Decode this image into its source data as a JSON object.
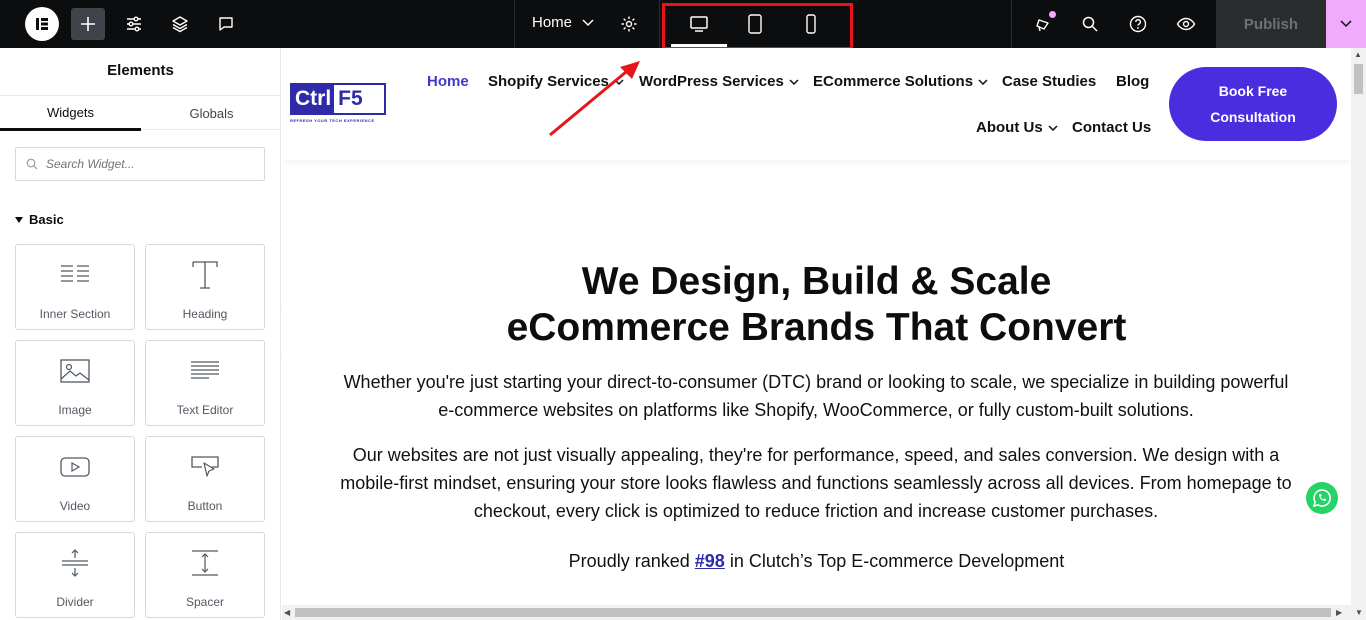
{
  "topbar": {
    "page_name": "Home",
    "publish_label": "Publish",
    "accent_color": "#f0abfc",
    "highlight_color": "#e8141c",
    "devices": [
      "desktop-icon",
      "tablet-icon",
      "mobile-icon"
    ],
    "active_device": "desktop"
  },
  "panel": {
    "title": "Elements",
    "tabs": [
      "Widgets",
      "Globals"
    ],
    "search_placeholder": "Search Widget...",
    "category": "Basic",
    "widgets": [
      {
        "label": "Inner Section",
        "icon": "inner-section-icon"
      },
      {
        "label": "Heading",
        "icon": "heading-icon"
      },
      {
        "label": "Image",
        "icon": "image-icon"
      },
      {
        "label": "Text Editor",
        "icon": "text-editor-icon"
      },
      {
        "label": "Video",
        "icon": "video-icon"
      },
      {
        "label": "Button",
        "icon": "button-icon"
      },
      {
        "label": "Divider",
        "icon": "divider-icon"
      },
      {
        "label": "Spacer",
        "icon": "spacer-icon"
      }
    ]
  },
  "site": {
    "logo_ctrl": "Ctrl",
    "logo_f5": "F5",
    "logo_tagline": "REFRESH YOUR TECH EXPERIENCE",
    "nav": {
      "home": "Home",
      "shopify": "Shopify Services",
      "wordpress": "WordPress Services",
      "ecommerce": "ECommerce Solutions",
      "case_studies": "Case Studies",
      "blog": "Blog",
      "about": "About Us",
      "contact": "Contact Us"
    },
    "cta_line1": "Book Free",
    "cta_line2": "Consultation",
    "brand_color": "#4b2de0",
    "hero_line1": "We Design, Build & Scale",
    "hero_line2": "eCommerce Brands That Convert",
    "para1": "Whether you're just starting your direct-to-consumer (DTC) brand or looking to scale, we specialize in building powerful e-commerce websites on platforms like Shopify, WooCommerce, or fully custom-built solutions.",
    "para2": "Our websites are not just visually appealing, they're for performance, speed, and sales conversion. We design with a mobile-first mindset, ensuring your store looks flawless and functions seamlessly across all devices. From homepage to checkout, every click is optimized to reduce friction and increase customer purchases.",
    "ranked_prefix": "Proudly ranked",
    "ranked_link": "#98",
    "ranked_suffix": "in Clutch’s Top E-commerce Development"
  }
}
